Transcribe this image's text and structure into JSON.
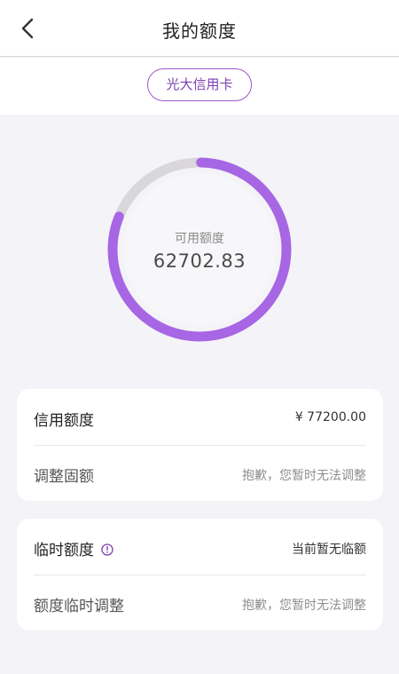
{
  "header": {
    "title": "我的额度"
  },
  "card_selector": {
    "label": "光大信用卡"
  },
  "available": {
    "label": "可用额度",
    "amount": "62702.83",
    "used_fraction": 0.188,
    "colors": {
      "available": "#a766e4",
      "used": "#d9d6dc"
    }
  },
  "credit": {
    "label": "信用额度",
    "value": "¥ 77200.00",
    "adjust_label": "调整固额",
    "adjust_status": "抱歉，您暂时无法调整"
  },
  "temporary": {
    "label": "临时额度",
    "status": "当前暂无临额",
    "adjust_label": "额度临时调整",
    "adjust_status": "抱歉，您暂时无法调整"
  },
  "icons": {
    "back": "chevron-left-icon",
    "info": "info-circle-icon"
  },
  "accent_color": "#7d3fb0"
}
